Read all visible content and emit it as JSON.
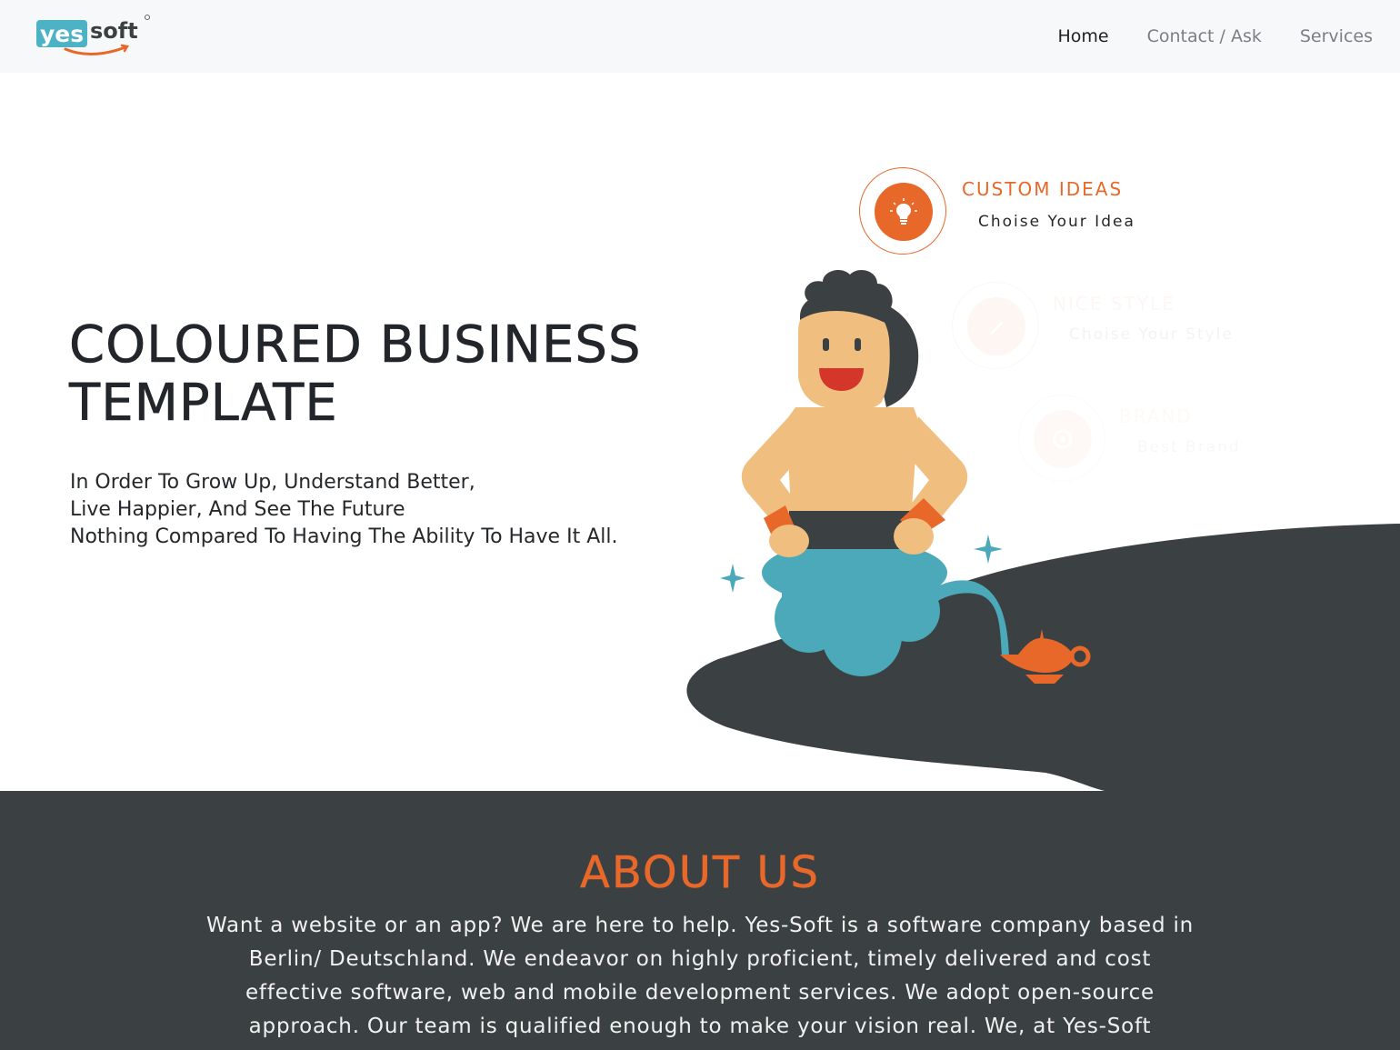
{
  "brand": {
    "logo_text_left": "yes",
    "logo_text_right": "soft",
    "accent": "#e8682a",
    "teal": "#4cb2c4",
    "dark": "#3b4142"
  },
  "nav": {
    "items": [
      {
        "label": "Home",
        "active": true
      },
      {
        "label": "Contact / Ask",
        "active": false
      },
      {
        "label": "Services",
        "active": false
      }
    ]
  },
  "hero": {
    "title_line1": "COLOURED BUSINESS",
    "title_line2": "TEMPLATE",
    "subtitle_lines": [
      "In Order To Grow Up, Understand Better,",
      "Live Happier, And See The Future",
      "Nothing Compared To Having The Ability To Have It All."
    ],
    "features": [
      {
        "title": "CUSTOM IDEAS",
        "subtitle": "Choise Your Idea",
        "icon": "lightbulb-icon"
      },
      {
        "title": "NICE STYLE",
        "subtitle": "Choise Your Style",
        "icon": "pencil-icon"
      },
      {
        "title": "BRAND",
        "subtitle": "Best Brand",
        "icon": "target-icon"
      }
    ]
  },
  "about": {
    "title": "ABOUT US",
    "lines": [
      "Want a website or an app? We are here to help. Yes-Soft is a software company based in",
      "Berlin/ Deutschland. We endeavor on highly proficient, timely delivered and cost",
      "effective software, web and mobile development services. We adopt open-source",
      "approach. Our team is qualified enough to make your vision real. We, at Yes-Soft"
    ]
  }
}
